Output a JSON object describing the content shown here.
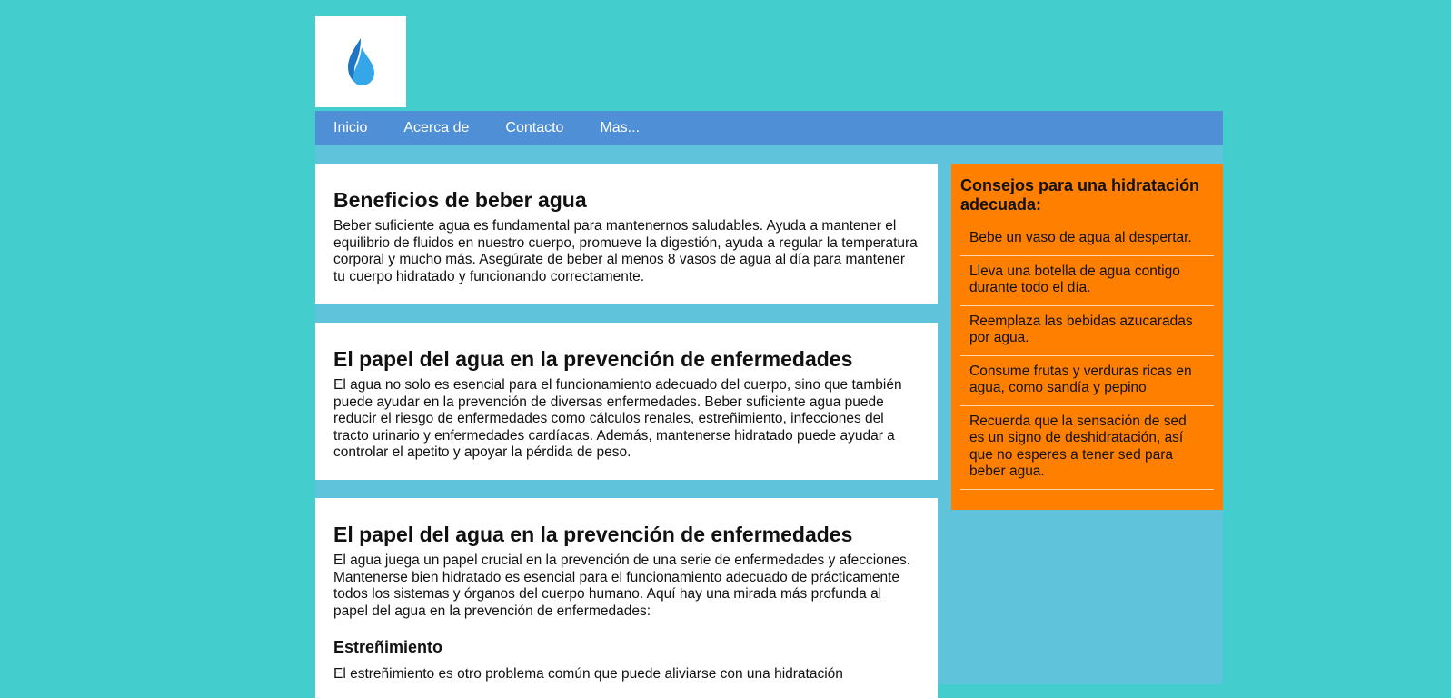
{
  "nav": {
    "items": [
      "Inicio",
      "Acerca de",
      "Contacto",
      "Mas..."
    ]
  },
  "logo": {
    "icon": "water-drop-icon",
    "colors": {
      "dark": "#1f77c4",
      "light": "#35a6e8"
    }
  },
  "colors": {
    "page_bg": "#43cdcd",
    "nav_bg": "#4f8fd6",
    "sidebar_bg": "#ff7f00",
    "container_bg": "#5fc3dc"
  },
  "main": {
    "sections": [
      {
        "title": "Beneficios de beber agua",
        "text": "Beber suficiente agua es fundamental para mantenernos saludables. Ayuda a mantener el equilibrio de fluidos en nuestro cuerpo, promueve la digestión, ayuda a regular la temperatura corporal y mucho más. Asegúrate de beber al menos 8 vasos de agua al día para mantener tu cuerpo hidratado y funcionando correctamente."
      },
      {
        "title": "El papel del agua en la prevención de enfermedades",
        "text": "El agua no solo es esencial para el funcionamiento adecuado del cuerpo, sino que también puede ayudar en la prevención de diversas enfermedades. Beber suficiente agua puede reducir el riesgo de enfermedades como cálculos renales, estreñimiento, infecciones del tracto urinario y enfermedades cardíacas. Además, mantenerse hidratado puede ayudar a controlar el apetito y apoyar la pérdida de peso."
      },
      {
        "title": "El papel del agua en la prevención de enfermedades",
        "text": "El agua juega un papel crucial en la prevención de una serie de enfermedades y afecciones. Mantenerse bien hidratado es esencial para el funcionamiento adecuado de prácticamente todos los sistemas y órganos del cuerpo humano. Aquí hay una mirada más profunda al papel del agua en la prevención de enfermedades:",
        "subtitle": "Estreñimiento",
        "subtext": "El estreñimiento es otro problema común que puede aliviarse con una hidratación"
      }
    ]
  },
  "sidebar": {
    "title": "Consejos para una hidratación adecuada:",
    "tips": [
      "Bebe un vaso de agua al despertar.",
      "Lleva una botella de agua contigo durante todo el día.",
      "Reemplaza las bebidas azucaradas por agua.",
      "Consume frutas y verduras ricas en agua, como sandía y pepino",
      "Recuerda que la sensación de sed es un signo de deshidratación, así que no esperes a tener sed para beber agua."
    ]
  }
}
